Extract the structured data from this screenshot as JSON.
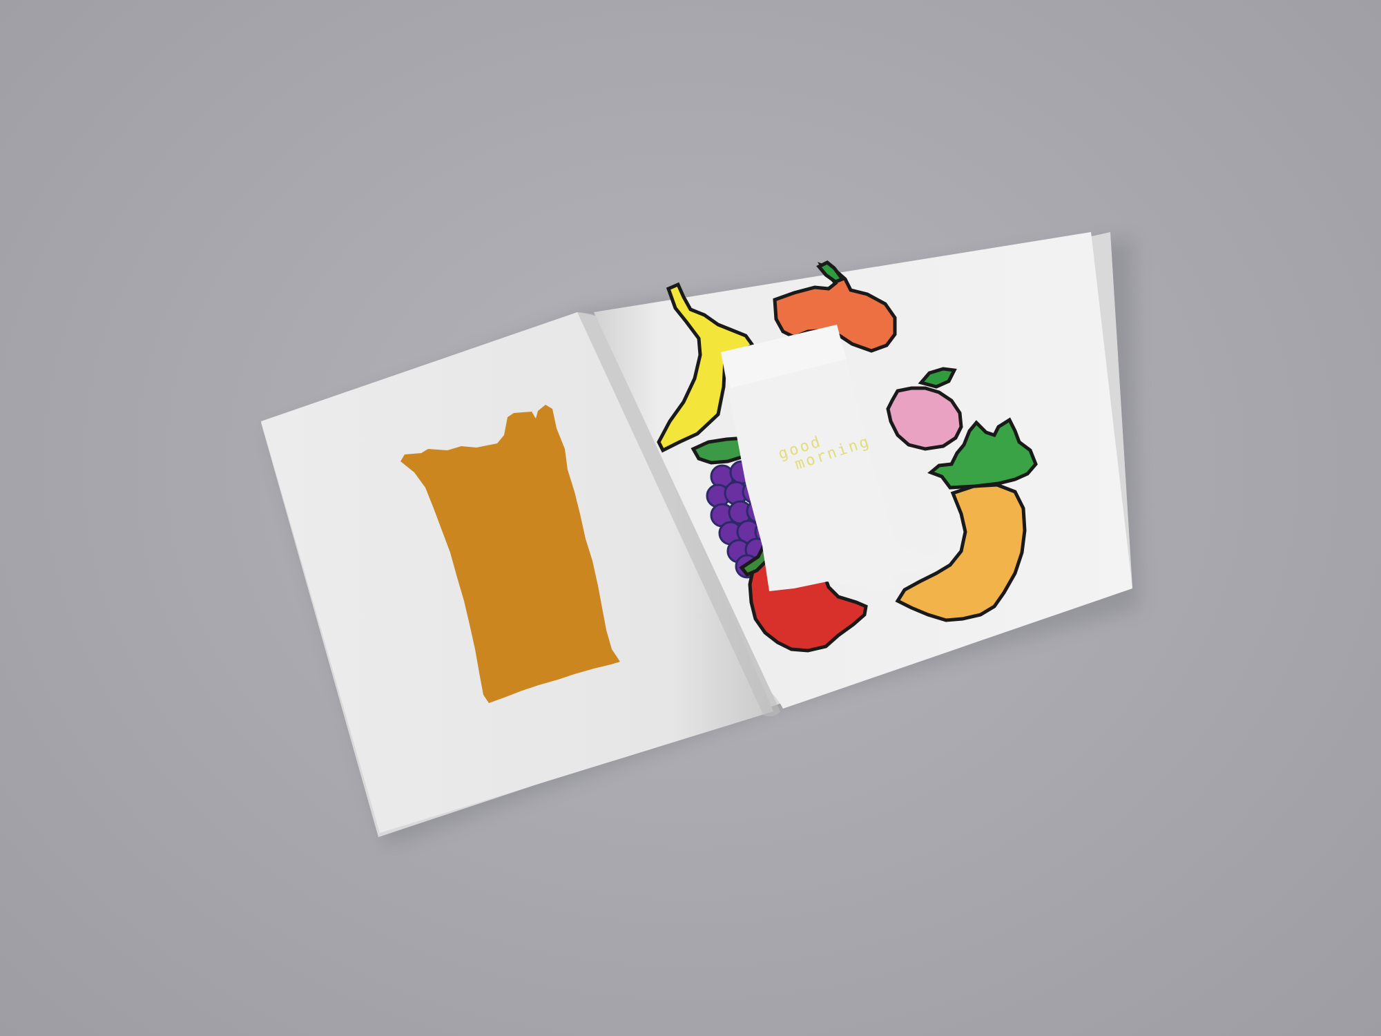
{
  "scene": {
    "background": "#a7a7ad",
    "page_color": "#eeeeee",
    "swatch_color": "#cc8620"
  },
  "right_page": {
    "greeting_line1": "good",
    "greeting_line2": "morning",
    "greeting_color": "#e2dc7a"
  },
  "illustrations": [
    {
      "name": "banana",
      "color": "#f3e53a"
    },
    {
      "name": "orange",
      "color": "#ec7041"
    },
    {
      "name": "peach",
      "color": "#e9a2c2"
    },
    {
      "name": "grapes",
      "color": "#6a2fa0"
    },
    {
      "name": "apple",
      "color": "#d8312b"
    },
    {
      "name": "pineapple",
      "color": "#f2b34b"
    }
  ]
}
